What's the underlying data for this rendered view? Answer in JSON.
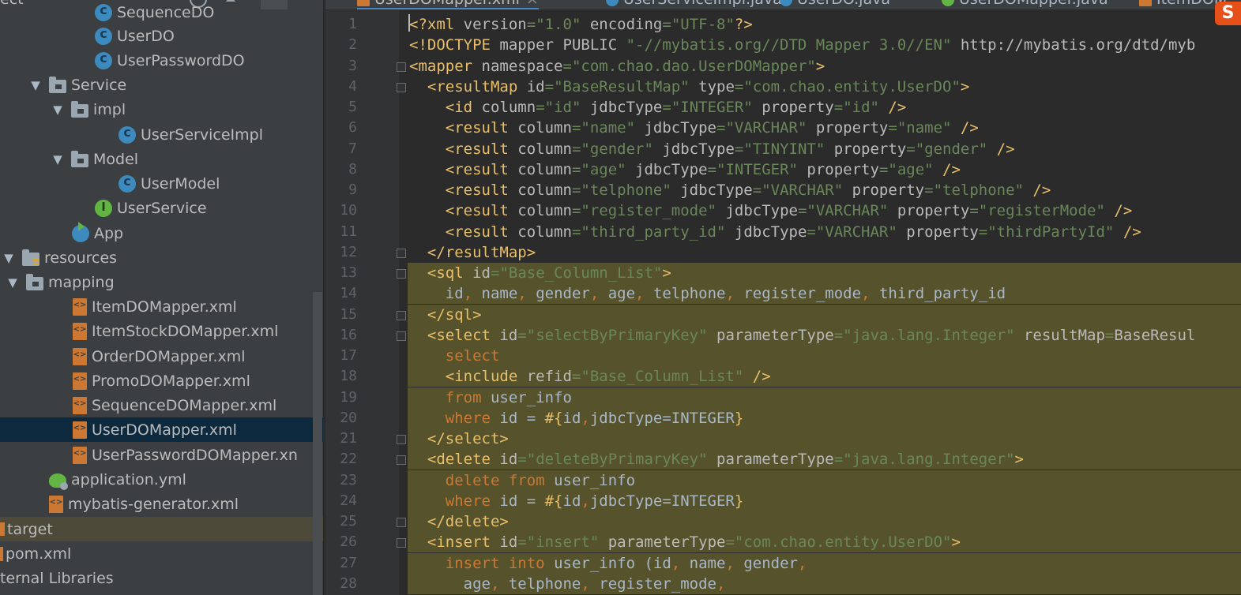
{
  "editor_tabs": [
    {
      "label": "UserDOMapper.xml",
      "icon": "xml-file-icon",
      "active": true
    },
    {
      "label": "UserServiceImpl.java",
      "icon": "java-class-icon",
      "active": false
    },
    {
      "label": "UserDO.java",
      "icon": "java-class-icon",
      "active": false
    },
    {
      "label": "UserDOMapper.java",
      "icon": "java-interface-icon",
      "active": false
    },
    {
      "label": "ItemDOM",
      "icon": "xml-file-icon",
      "active": false
    }
  ],
  "project_tree": [
    {
      "label": "SequenceDO",
      "icon": "java-class-icon"
    },
    {
      "label": "UserDO",
      "icon": "java-class-icon"
    },
    {
      "label": "UserPasswordDO",
      "icon": "java-class-icon"
    },
    {
      "label": "Service",
      "icon": "package-folder-icon",
      "expanded": true
    },
    {
      "label": "impl",
      "icon": "package-folder-icon",
      "expanded": true
    },
    {
      "label": "UserServiceImpl",
      "icon": "java-class-icon"
    },
    {
      "label": "Model",
      "icon": "package-folder-icon",
      "expanded": true
    },
    {
      "label": "UserModel",
      "icon": "java-class-icon"
    },
    {
      "label": "UserService",
      "icon": "java-interface-icon"
    },
    {
      "label": "App",
      "icon": "spring-app-icon"
    },
    {
      "label": "resources",
      "icon": "resources-folder-icon",
      "expanded": true
    },
    {
      "label": "mapping",
      "icon": "folder-icon",
      "expanded": true
    },
    {
      "label": "ItemDOMapper.xml",
      "icon": "xml-file-icon"
    },
    {
      "label": "ItemStockDOMapper.xml",
      "icon": "xml-file-icon"
    },
    {
      "label": "OrderDOMapper.xml",
      "icon": "xml-file-icon"
    },
    {
      "label": "PromoDOMapper.xml",
      "icon": "xml-file-icon"
    },
    {
      "label": "SequenceDOMapper.xml",
      "icon": "xml-file-icon"
    },
    {
      "label": "UserDOMapper.xml",
      "icon": "xml-file-icon",
      "selected": true
    },
    {
      "label": "UserPasswordDOMapper.xn",
      "icon": "xml-file-icon"
    },
    {
      "label": "application.yml",
      "icon": "yaml-config-icon"
    },
    {
      "label": "mybatis-generator.xml",
      "icon": "xml-file-icon"
    },
    {
      "label": "target",
      "icon": "folder-icon",
      "excluded": true
    },
    {
      "label": "pom.xml",
      "icon": "maven-icon"
    },
    {
      "label": "ternal Libraries",
      "icon": "library-icon"
    }
  ],
  "sidebar_toolbar": {
    "label": "ect"
  },
  "line_numbers": [
    "1",
    "2",
    "3",
    "4",
    "5",
    "6",
    "7",
    "8",
    "9",
    "10",
    "11",
    "12",
    "13",
    "14",
    "15",
    "16",
    "17",
    "18",
    "19",
    "20",
    "21",
    "22",
    "23",
    "24",
    "25",
    "26",
    "27",
    "28"
  ],
  "code_lines": [
    "<?xml version=\"1.0\" encoding=\"UTF-8\"?>",
    "<!DOCTYPE mapper PUBLIC \"-//mybatis.org//DTD Mapper 3.0//EN\" \"http://mybatis.org/dtd/myb",
    "<mapper namespace=\"com.chao.dao.UserDOMapper\">",
    "  <resultMap id=\"BaseResultMap\" type=\"com.chao.entity.UserDO\">",
    "    <id column=\"id\" jdbcType=\"INTEGER\" property=\"id\" />",
    "    <result column=\"name\" jdbcType=\"VARCHAR\" property=\"name\" />",
    "    <result column=\"gender\" jdbcType=\"TINYINT\" property=\"gender\" />",
    "    <result column=\"age\" jdbcType=\"INTEGER\" property=\"age\" />",
    "    <result column=\"telphone\" jdbcType=\"VARCHAR\" property=\"telphone\" />",
    "    <result column=\"register_mode\" jdbcType=\"VARCHAR\" property=\"registerMode\" />",
    "    <result column=\"third_party_id\" jdbcType=\"VARCHAR\" property=\"thirdPartyId\" />",
    "  </resultMap>",
    "  <sql id=\"Base_Column_List\">",
    "    id, name, gender, age, telphone, register_mode, third_party_id",
    "  </sql>",
    "  <select id=\"selectByPrimaryKey\" parameterType=\"java.lang.Integer\" resultMap=\"BaseResul",
    "    select",
    "    <include refid=\"Base_Column_List\" />",
    "    from user_info",
    "    where id = #{id,jdbcType=INTEGER}",
    "  </select>",
    "  <delete id=\"deleteByPrimaryKey\" parameterType=\"java.lang.Integer\">",
    "    delete from user_info",
    "    where id = #{id,jdbcType=INTEGER}",
    "  </delete>",
    "  <insert id=\"insert\" parameterType=\"com.chao.entity.UserDO\">",
    "    insert into user_info (id, name, gender,",
    "      age, telphone, register_mode,"
  ],
  "colors": {
    "tag": "#e8bf6a",
    "attribute": "#bababa",
    "string": "#6a8759",
    "keyword": "#cc7832",
    "text": "#a9b7c6",
    "sql_highlight": "#56532c",
    "selection": "#0d293e"
  },
  "logo_text": "S"
}
